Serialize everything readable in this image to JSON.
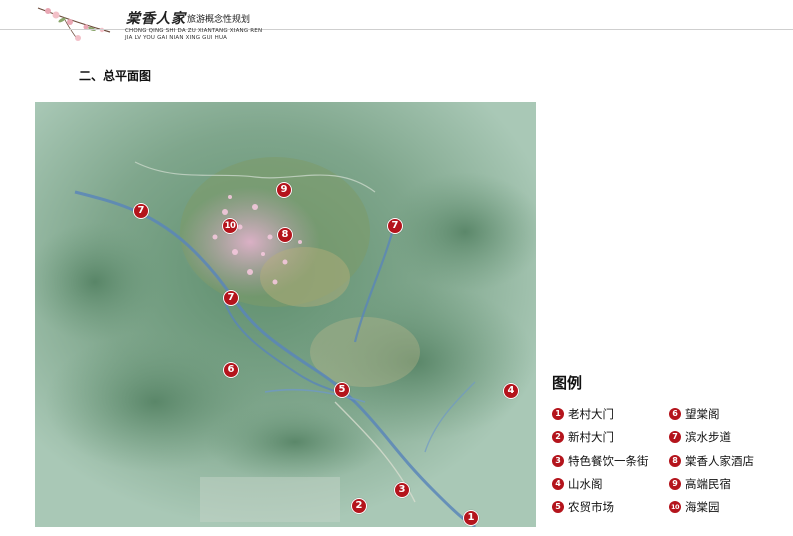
{
  "header": {
    "brand_cn": "棠香人家",
    "brand_sub": "旅游概念性规划",
    "brand_en_line1": "CHONG QING SHI DA ZU XIANTANG XIANG REN",
    "brand_en_line2": "JIA LV YOU GAI NIAN XING GUI HUA"
  },
  "section_title": "二、总平面图",
  "map_markers": [
    {
      "num": "1"
    },
    {
      "num": "2"
    },
    {
      "num": "3"
    },
    {
      "num": "4"
    },
    {
      "num": "5"
    },
    {
      "num": "6"
    },
    {
      "num": "7"
    },
    {
      "num": "7"
    },
    {
      "num": "7"
    },
    {
      "num": "8"
    },
    {
      "num": "9"
    },
    {
      "num": "10"
    }
  ],
  "legend": {
    "title": "图例",
    "items": [
      {
        "num": "1",
        "label": "老村大门"
      },
      {
        "num": "2",
        "label": "新村大门"
      },
      {
        "num": "3",
        "label": "特色餐饮一条街"
      },
      {
        "num": "4",
        "label": "山水阁"
      },
      {
        "num": "5",
        "label": "农贸市场"
      },
      {
        "num": "6",
        "label": "望棠阁"
      },
      {
        "num": "7",
        "label": "滨水步道"
      },
      {
        "num": "8",
        "label": "棠香人家酒店"
      },
      {
        "num": "9",
        "label": "高端民宿"
      },
      {
        "num": "10",
        "label": "海棠园"
      }
    ]
  },
  "colors": {
    "marker_red": "#b4141c",
    "map_green": "#8fb5a0",
    "river_blue": "#5a86b8"
  }
}
